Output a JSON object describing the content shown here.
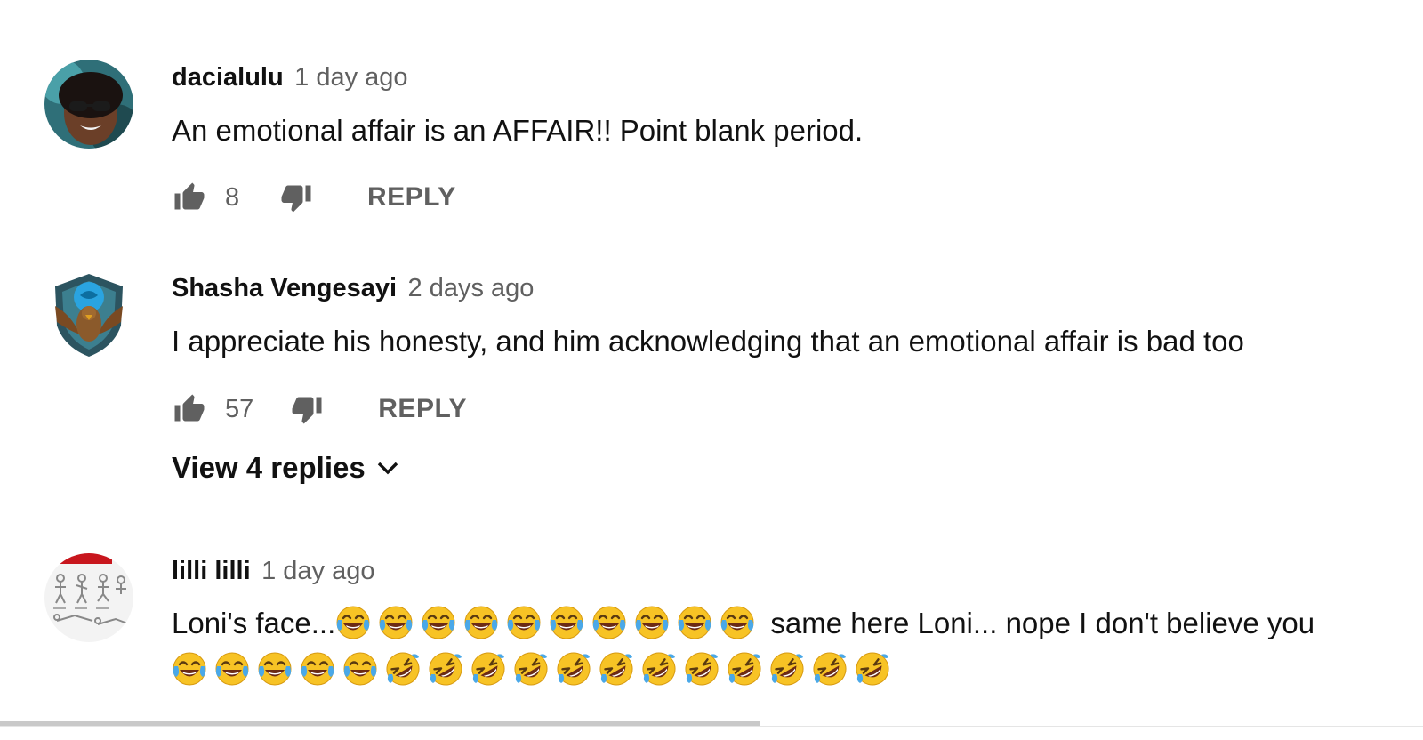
{
  "comments": [
    {
      "author": "dacialulu",
      "time": "1 day ago",
      "text": "An emotional affair is an AFFAIR!! Point blank period.",
      "likes": "8",
      "reply_label": "REPLY",
      "avatar_icon": "avatar-woman-sunglasses"
    },
    {
      "author": "Shasha Vengesayi",
      "time": "2 days ago",
      "text": "I appreciate his honesty, and him acknowledging that an emotional affair is bad too",
      "likes": "57",
      "reply_label": "REPLY",
      "view_replies": "View 4 replies",
      "avatar_icon": "avatar-eagle-crest"
    },
    {
      "author": "lilli lilli",
      "time": "1 day ago",
      "text_part1": "Loni's face...",
      "text_part2": "same here Loni... nope I don't believe you",
      "avatar_icon": "avatar-workout-chart",
      "emoji_line1": {
        "joy": 10
      },
      "emoji_line2": {
        "joy": 5,
        "rofl": 12
      }
    }
  ],
  "icons": {
    "like": "thumbs-up-icon",
    "dislike": "thumbs-down-icon",
    "expand": "chevron-down-icon",
    "joy": "face-with-tears-of-joy-emoji",
    "rofl": "rolling-on-floor-laughing-emoji"
  },
  "colors": {
    "text": "#111111",
    "secondary": "#606060",
    "emoji_face": "#F7C325",
    "emoji_tear": "#4AA8E8"
  }
}
